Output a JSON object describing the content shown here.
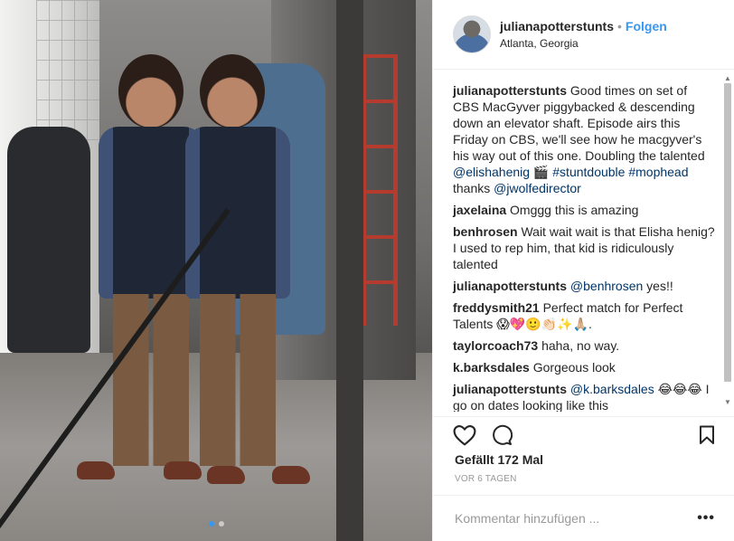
{
  "post": {
    "image": {
      "carousel_count": 2,
      "carousel_index": 1,
      "accent": "#3897f0"
    },
    "header": {
      "username": "julianapotterstunts",
      "separator": "•",
      "follow_label": "Folgen",
      "location": "Atlanta, Georgia",
      "avatar_icon": "avatar-icon"
    },
    "comments": [
      {
        "user": "julianapotterstunts",
        "segments": [
          {
            "t": "Good times on set of CBS MacGyver piggybacked & descending down an elevator shaft. Episode airs this Friday on CBS, we'll see how he macgyver's his way out of this one. Doubling the talented "
          },
          {
            "t": "@elishahenig",
            "link": true
          },
          {
            "t": " 🎬 "
          },
          {
            "t": "#stuntdouble",
            "link": true
          },
          {
            "t": " "
          },
          {
            "t": "#mophead",
            "link": true
          },
          {
            "t": " thanks "
          },
          {
            "t": "@jwolfedirector",
            "link": true
          }
        ]
      },
      {
        "user": "jaxelaina",
        "segments": [
          {
            "t": "Omggg this is amazing"
          }
        ]
      },
      {
        "user": "benhrosen",
        "segments": [
          {
            "t": "Wait wait wait is that Elisha henig? I used to rep him, that kid is ridiculously talented"
          }
        ]
      },
      {
        "user": "julianapotterstunts",
        "segments": [
          {
            "t": "@benhrosen",
            "link": true
          },
          {
            "t": " yes!!"
          }
        ]
      },
      {
        "user": "freddysmith21",
        "segments": [
          {
            "t": "Perfect match for Perfect Talents 😱💖🙂👏🏻✨🙏🏼."
          }
        ]
      },
      {
        "user": "taylorcoach73",
        "segments": [
          {
            "t": "haha, no way."
          }
        ]
      },
      {
        "user": "k.barksdales",
        "segments": [
          {
            "t": "Gorgeous look"
          }
        ]
      },
      {
        "user": "julianapotterstunts",
        "segments": [
          {
            "t": "@k.barksdales",
            "link": true
          },
          {
            "t": " 😂😂😂 I go on dates looking like this"
          }
        ]
      }
    ],
    "actions": {
      "like_icon": "heart-icon",
      "comment_icon": "comment-bubble-icon",
      "save_icon": "bookmark-icon"
    },
    "likes_text": "Gefällt 172 Mal",
    "timestamp": "VOR 6 TAGEN",
    "composer": {
      "placeholder": "Kommentar hinzufügen ...",
      "more_label": "•••"
    },
    "colors": {
      "link": "#003569",
      "follow": "#3897f0",
      "border": "#efefef"
    }
  }
}
